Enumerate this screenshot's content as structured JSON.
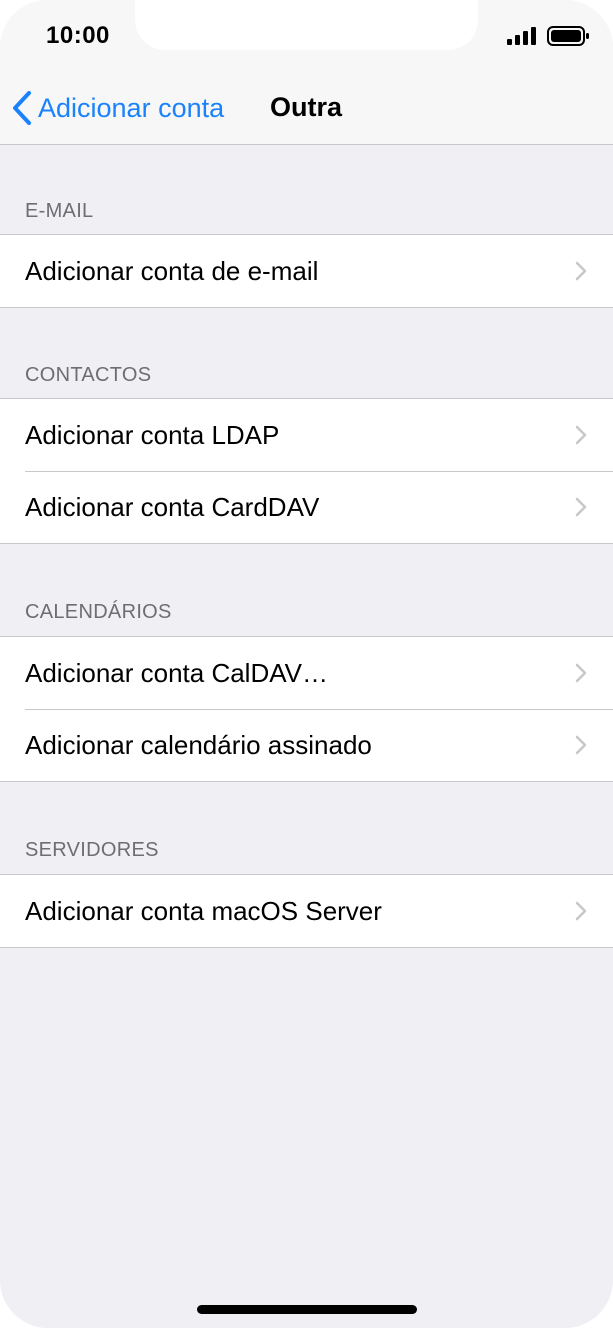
{
  "status_bar": {
    "time": "10:00",
    "signal_icon": "cellular-signal-icon",
    "battery_icon": "battery-icon"
  },
  "nav": {
    "back_label": "Adicionar conta",
    "title": "Outra",
    "accent_color": "#1a82fb"
  },
  "sections": [
    {
      "header": "E-MAIL",
      "items": [
        {
          "label": "Adicionar conta de e-mail"
        }
      ]
    },
    {
      "header": "CONTACTOS",
      "items": [
        {
          "label": "Adicionar conta LDAP"
        },
        {
          "label": "Adicionar conta CardDAV"
        }
      ]
    },
    {
      "header": "CALENDÁRIOS",
      "items": [
        {
          "label": "Adicionar conta CalDAV…"
        },
        {
          "label": "Adicionar calendário assinado"
        }
      ]
    },
    {
      "header": "SERVIDORES",
      "items": [
        {
          "label": "Adicionar conta macOS Server"
        }
      ]
    }
  ]
}
